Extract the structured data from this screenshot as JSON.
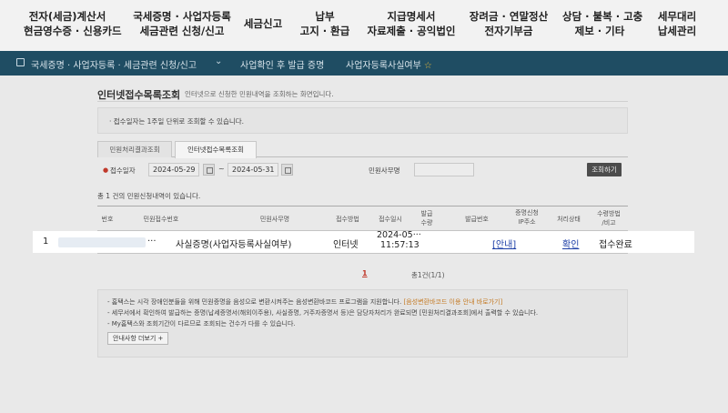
{
  "topnav": [
    {
      "l1": "전자(세금)계산서",
      "l2": "현금영수증 · 신용카드"
    },
    {
      "l1": "국세증명 · 사업자등록",
      "l2": "세금관련 신청/신고"
    },
    {
      "l1": "세금신고",
      "l2": ""
    },
    {
      "l1": "납부",
      "l2": "고지 · 환급"
    },
    {
      "l1": "지급명세서",
      "l2": "자료제출 · 공익법인"
    },
    {
      "l1": "장려금 · 연말정산",
      "l2": "전자기부금"
    },
    {
      "l1": "상담 · 불복 · 고충",
      "l2": "제보 · 기타"
    },
    {
      "l1": "세무대리",
      "l2": "납세관리"
    }
  ],
  "breadcrumb": {
    "level1": "국세증명 · 사업자등록 · 세금관련 신청/신고",
    "level2": "사업확인 후 발급 증명",
    "level3": "사업자등록사실여부"
  },
  "page": {
    "title": "인터넷접수목록조회",
    "description": "인터넷으로 신청한 민원내역을 조회하는 화면입니다."
  },
  "notice": "· 접수일자는 1주일 단위로 조회할 수 있습니다.",
  "tabs": [
    "민원처리결과조회",
    "인터넷접수목록조회"
  ],
  "search": {
    "date_label": "접수일자",
    "date_from": "2024-05-29",
    "date_to": "2024-05-31",
    "tilde": "~",
    "office_label": "민원사무명",
    "button": "조회하기"
  },
  "count_text": "총 1 건의 민원신청내역이 있습니다.",
  "table": {
    "headers": {
      "no": "번호",
      "receipt_no": "민원접수번호",
      "name": "민원사무명",
      "method": "접수방법",
      "datetime": "접수일시",
      "issue1": "발급",
      "issue2": "수량",
      "issue_no": "발급번호",
      "cert1": "증명신청",
      "cert2": "IP주소",
      "status": "처리상태",
      "recv1": "수령방법",
      "recv2": "/비고"
    },
    "row": {
      "no": "1",
      "receipt_no": "···",
      "name": "사실증명(사업자등록사실여부)",
      "method": "인터넷",
      "date": "2024-05···",
      "time": "11:57:13",
      "ip_link": "[안내]",
      "status_link": "확인",
      "receive": "접수완료"
    }
  },
  "pager": {
    "current": "1",
    "total": "1/1",
    "total_prefix": "총1건("
  },
  "info": {
    "line1": "- 홈택스는 시각 장애인분들을 위해 민원증명을 음성으로 변환시켜주는 음성변환바코드 프로그램을 지원합니다.",
    "line1_highlight": "[음성변환바코드 이용 안내 바로가기]",
    "line2": "- 세무서에서 확인하여 발급하는 증명(납세증명서(해외이주용), 사실증명, 거주자증명서 등)은 담당자처리가 완료되면 [민원처리결과조회]에서 출력할 수 있습니다.",
    "line3": "- My홈택스와 조회기간이 다르므로 조회되는 건수가 다를 수 있습니다.",
    "more_button": "안내사항 더보기 +"
  }
}
